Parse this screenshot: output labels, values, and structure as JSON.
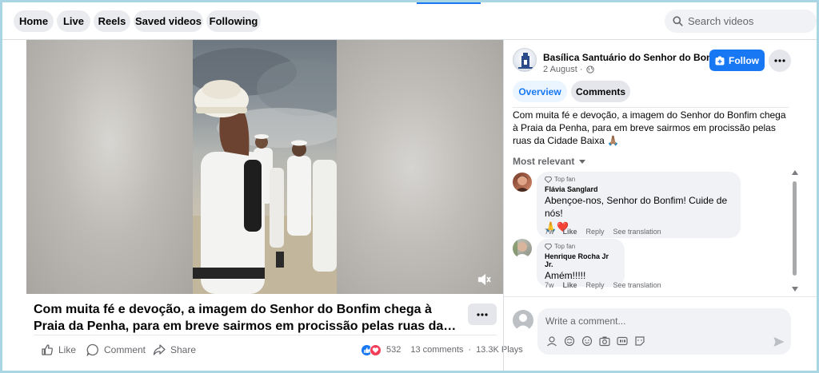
{
  "nav": {
    "tabs": [
      {
        "label": "Home"
      },
      {
        "label": "Live"
      },
      {
        "label": "Reels"
      },
      {
        "label": "Saved videos"
      },
      {
        "label": "Following"
      }
    ],
    "search_placeholder": "Search videos"
  },
  "video": {
    "mute_icon": "speaker-muted-icon"
  },
  "post": {
    "title": "Com muita fé e devoção, a imagem do Senhor do Bonfim chega à Praia da Penha, para em breve sairmos em procissão pelas ruas da Cidade Baixa",
    "actions": {
      "like": "Like",
      "comment": "Comment",
      "share": "Share"
    },
    "stats": {
      "reactions": "532",
      "comments": "13 comments",
      "plays": "13.3K Plays"
    }
  },
  "page": {
    "name": "Basílica Santuário do Senhor do Bonfim",
    "date": "2 August ·",
    "follow_label": "Follow"
  },
  "tabs": {
    "overview": "Overview",
    "comments": "Comments"
  },
  "description": "Com muita fé e devoção, a imagem do Senhor do Bonfim chega à Praia da Penha, para em breve sairmos em procissão pelas ruas da Cidade Baixa 🙏🏽",
  "sort_label": "Most relevant",
  "comments": [
    {
      "badge": "Top fan",
      "author": "Flávia Sanglard",
      "text": "Abençoe-nos, Senhor do Bonfim! Cuide de nós!",
      "text2": "🙏❤️",
      "time": "7w",
      "like": "Like",
      "reply": "Reply",
      "translate": "See translation"
    },
    {
      "badge": "Top fan",
      "author": "Henrique Rocha Jr Jr.",
      "text": "Amém!!!!!",
      "time": "7w",
      "like": "Like",
      "reply": "Reply",
      "translate": "See translation"
    }
  ],
  "composer": {
    "placeholder": "Write a comment..."
  },
  "colors": {
    "accent": "#1877f2",
    "pill_bg": "#e9ebee",
    "tab_active_bg": "#ebf5ff",
    "tab_active_text": "#1877f2"
  }
}
